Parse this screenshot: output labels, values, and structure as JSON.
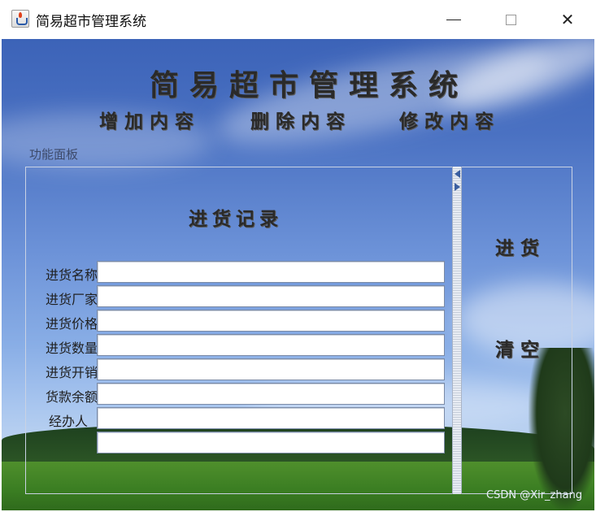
{
  "window": {
    "title": "简易超市管理系统",
    "controls": {
      "minimize": "—",
      "maximize": "☐",
      "close": "✕"
    }
  },
  "header": {
    "title": "简易超市管理系统",
    "menu": [
      {
        "label": "增加内容"
      },
      {
        "label": "删除内容"
      },
      {
        "label": "修改内容"
      }
    ]
  },
  "panel": {
    "label": "功能面板",
    "form_title": "进货记录",
    "fields": [
      {
        "label": "进货名称",
        "value": ""
      },
      {
        "label": "进货厂家",
        "value": ""
      },
      {
        "label": "进货价格",
        "value": ""
      },
      {
        "label": "进货数量",
        "value": ""
      },
      {
        "label": "进货开销",
        "value": ""
      },
      {
        "label": "货款余额",
        "value": ""
      },
      {
        "label": "经办人",
        "value": ""
      },
      {
        "label": "",
        "value": ""
      }
    ],
    "buttons": {
      "stock": "进货",
      "clear": "清空"
    }
  },
  "watermark": "CSDN @Xir_zhang",
  "colors": {
    "sky_top": "#3c63b8",
    "sky_bottom": "#bcd3f0",
    "grass": "#3a7d22"
  }
}
